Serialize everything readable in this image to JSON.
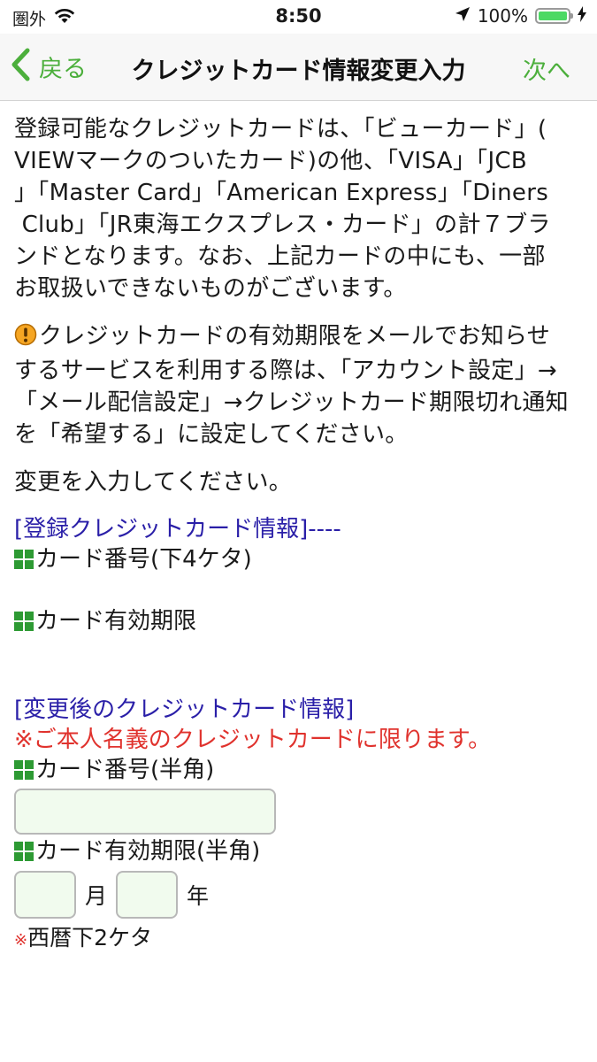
{
  "status_bar": {
    "carrier": "圏外",
    "time": "8:50",
    "battery": "100%",
    "battery_level": 1.0
  },
  "nav": {
    "back_label": "戻る",
    "title": "クレジットカード情報変更入力",
    "next_label": "次へ"
  },
  "intro": {
    "lines": [
      "登録可能なクレジットカードは、「ビューカード」(",
      "VIEWマークのついたカード)の他、「VISA」「JCB",
      "」「Master Card」「American Express」「Diners",
      " Club」「JR東海エクスプレス・カード」の計７ブラ",
      "ンドとなります。なお、上記カードの中にも、一部",
      "お取扱いできないものがございます。"
    ]
  },
  "notice": {
    "icon": "warning-icon",
    "lines": [
      "クレジットカードの有効期限をメールでお知らせ",
      "するサービスを利用する際は、「アカウント設定」→",
      "「メール配信設定」→クレジットカード期限切れ通知",
      "を「希望する」に設定してください。"
    ]
  },
  "instruction": "変更を入力してください。",
  "registered": {
    "heading": "[登録クレジットカード情報]----",
    "card_number_label": "カード番号(下4ケタ)",
    "card_number_value": "",
    "expiry_label": "カード有効期限",
    "expiry_value": ""
  },
  "new_card": {
    "heading": "[変更後のクレジットカード情報]",
    "warning": "※ご本人名義のクレジットカードに限ります。",
    "card_number_label": "カード番号(半角)",
    "card_number_value": "",
    "expiry_label": "カード有効期限(半角)",
    "month_value": "",
    "month_unit": "月",
    "year_value": "",
    "year_unit": "年",
    "note_mark": "※",
    "note_text": "西暦下2ケタ"
  },
  "colors": {
    "accent_green": "#4caf3c",
    "link_blue": "#2a1fa8",
    "warning_red": "#e0322d",
    "input_bg": "#f1fbee",
    "icon_green": "#2d9a33",
    "battery_green": "#4cd964"
  }
}
